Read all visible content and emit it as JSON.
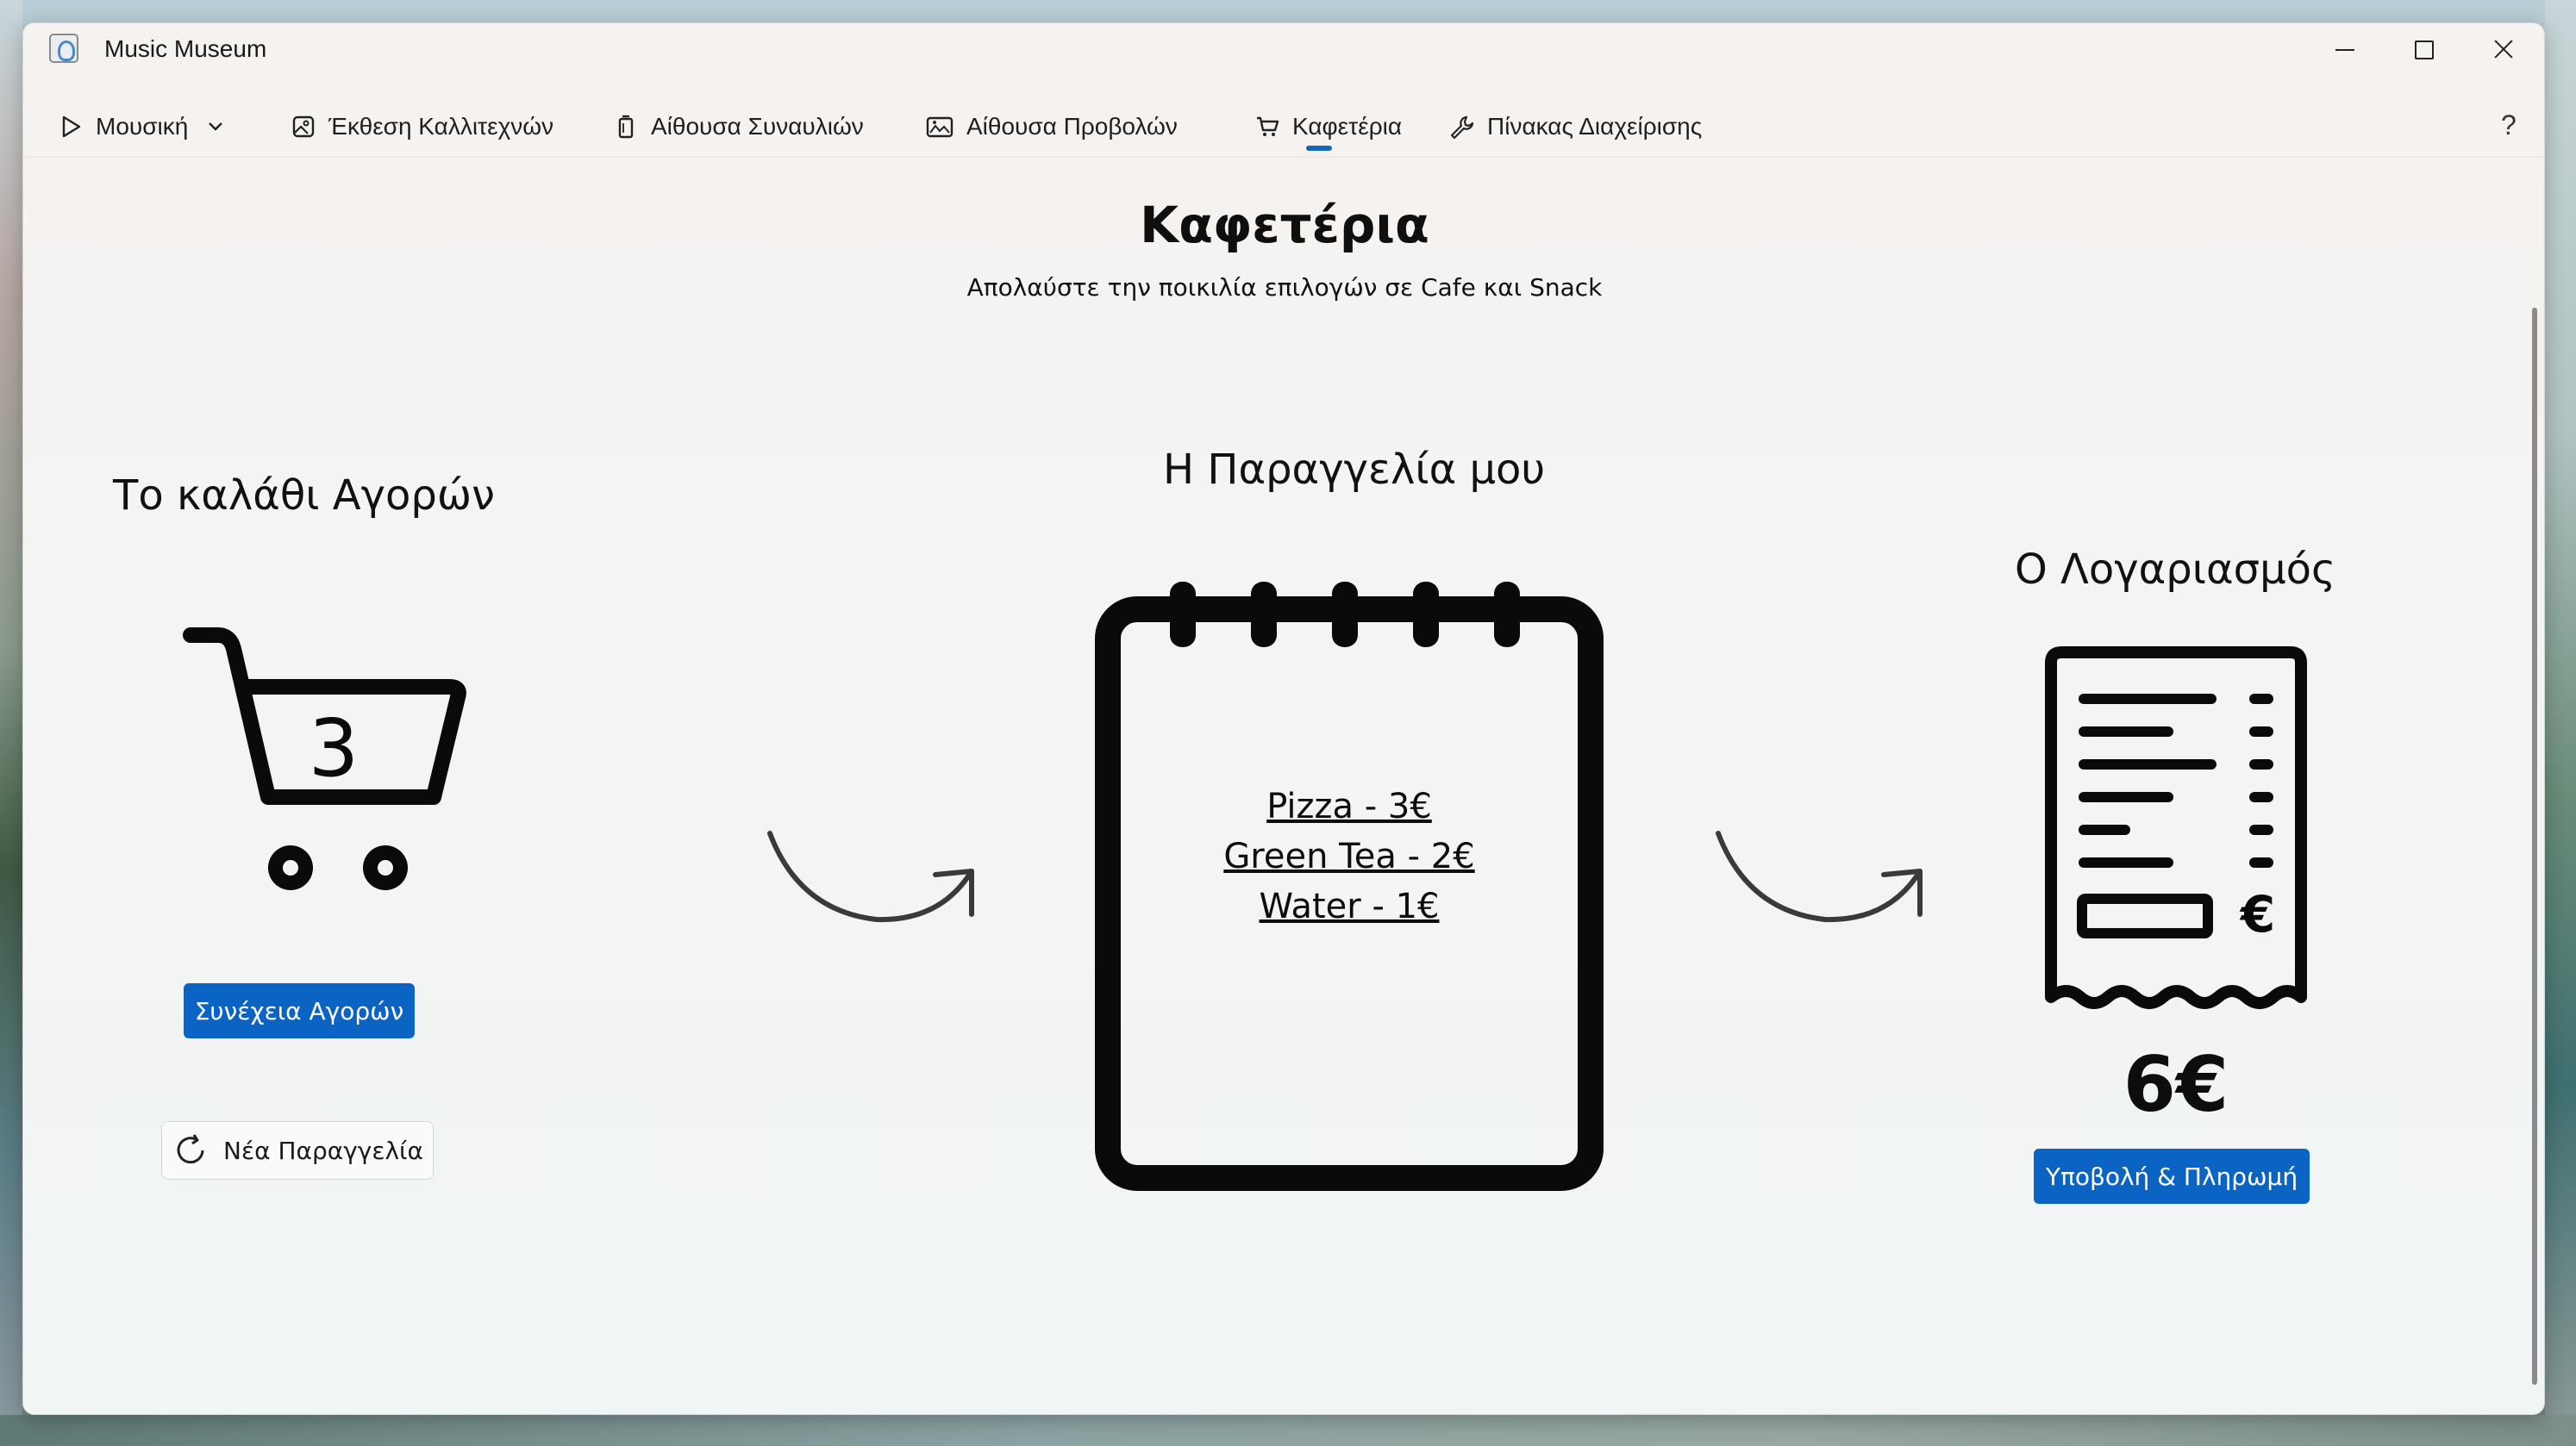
{
  "window": {
    "app_title": "Music Museum"
  },
  "nav": {
    "items": [
      {
        "label": "Μουσική",
        "icon": "play-icon"
      },
      {
        "label": "Έκθεση Καλλιτεχνών",
        "icon": "image-icon"
      },
      {
        "label": "Αίθουσα Συναυλιών",
        "icon": "ticket-icon"
      },
      {
        "label": "Αίθουσα Προβολών",
        "icon": "gallery-icon"
      },
      {
        "label": "Καφετέρια",
        "icon": "cart-icon",
        "selected": true
      },
      {
        "label": "Πίνακας Διαχείρισης",
        "icon": "wrench-icon"
      }
    ],
    "help_label": "?"
  },
  "page": {
    "title": "Καφετέρια",
    "subtitle": "Απολαύστε την ποικιλία επιλογών σε Cafe και Snack"
  },
  "cart_section": {
    "heading": "Το καλάθι Αγορών",
    "item_count": "3",
    "continue_label": "Συνέχεια Αγορών",
    "new_order_label": "Νέα Παραγγελία"
  },
  "order_section": {
    "heading": "Η Παραγγελία μου",
    "items": [
      "Pizza - 3€",
      "Green Tea - 2€",
      "Water - 1€"
    ]
  },
  "bill_section": {
    "heading": "Ο Λογαριασμός",
    "currency_symbol": "€",
    "total": "6€",
    "submit_label": "Υποβολή & Πληρωμή"
  },
  "colors": {
    "accent": "#0b63c4",
    "selected_indicator": "#1466c4",
    "text": "#111111"
  }
}
